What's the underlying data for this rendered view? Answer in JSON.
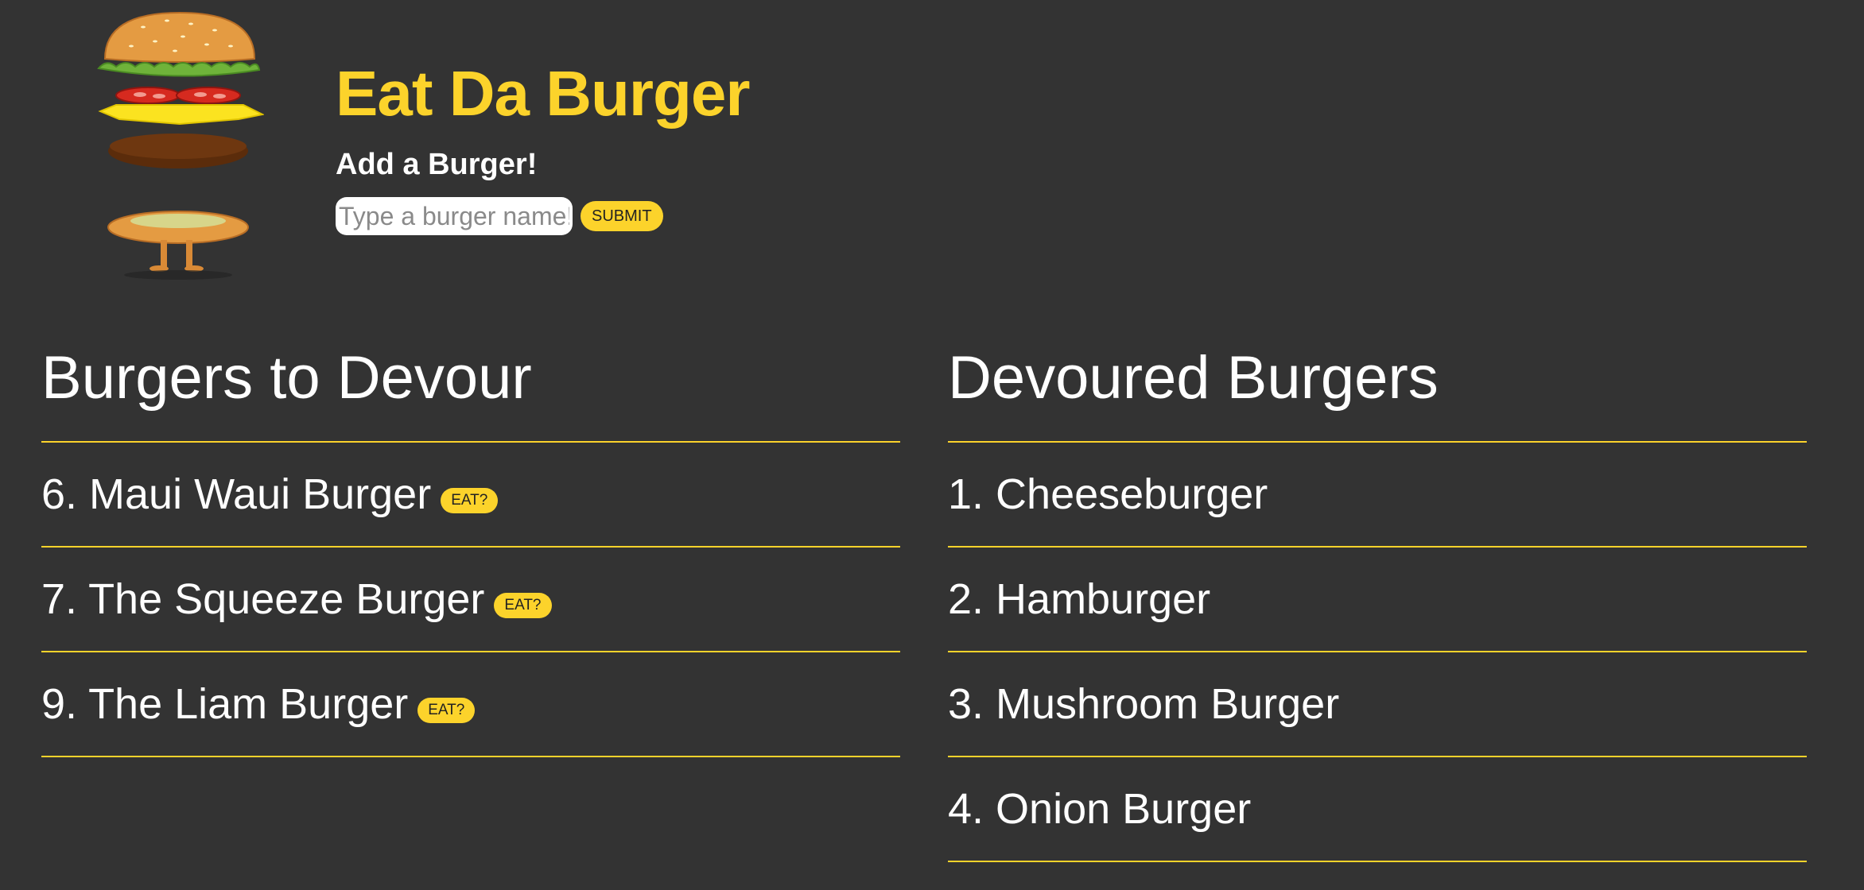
{
  "header": {
    "logo_icon": "burger-character-icon",
    "title": "Eat Da Burger",
    "subtitle": "Add a Burger!",
    "input_placeholder": "Type a burger name!",
    "input_value": "",
    "submit_label": "SUBMIT"
  },
  "to_devour": {
    "heading": "Burgers to Devour",
    "items": [
      {
        "label": "6. Maui Waui Burger",
        "button": "EAT?"
      },
      {
        "label": "7. The Squeeze Burger",
        "button": "EAT?"
      },
      {
        "label": "9. The Liam Burger",
        "button": "EAT?"
      }
    ]
  },
  "devoured": {
    "heading": "Devoured Burgers",
    "items": [
      {
        "label": "1. Cheeseburger"
      },
      {
        "label": "2. Hamburger"
      },
      {
        "label": "3. Mushroom Burger"
      },
      {
        "label": "4. Onion Burger"
      }
    ]
  },
  "colors": {
    "background": "#333333",
    "accent": "#fcd32b",
    "text": "#ffffff"
  }
}
